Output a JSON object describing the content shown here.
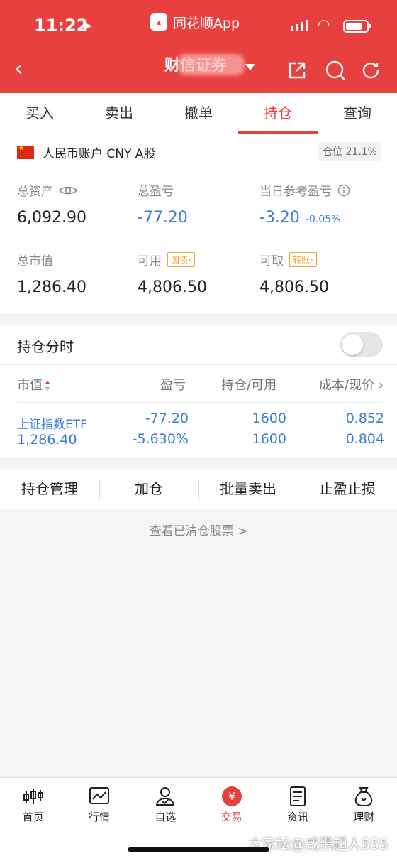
{
  "status_bar": {
    "time": "11:22",
    "app_name": "同花顺App"
  },
  "header": {
    "title": "财信证券",
    "accent_color": "#e8403f"
  },
  "tabs": [
    {
      "label": "买入"
    },
    {
      "label": "卖出"
    },
    {
      "label": "撤单"
    },
    {
      "label": "持仓",
      "active": true
    },
    {
      "label": "查询"
    }
  ],
  "account": {
    "name": "人民币账户 CNY A股",
    "position_ratio": "仓位 21.1%",
    "total_assets": {
      "label": "总资产",
      "value": "6,092.90"
    },
    "total_pnl": {
      "label": "总盈亏",
      "value": "-77.20"
    },
    "daily_pnl": {
      "label": "当日参考盈亏",
      "value": "-3.20",
      "pct": "-0.05%"
    },
    "market_value": {
      "label": "总市值",
      "value": "1,286.40"
    },
    "available": {
      "label": "可用",
      "tag": "国债",
      "value": "4,806.50"
    },
    "withdrawable": {
      "label": "可取",
      "tag": "转账",
      "value": "4,806.50"
    }
  },
  "position_timeshare": {
    "label": "持仓分时",
    "enabled": false
  },
  "table": {
    "headers": [
      "市值",
      "盈亏",
      "持仓/可用",
      "成本/现价"
    ],
    "rows": [
      {
        "name": "上证指数ETF",
        "market_value": "1,286.40",
        "pnl": "-77.20",
        "pnl_pct": "-5.630%",
        "holding": "1600",
        "available": "1600",
        "cost": "0.852",
        "price": "0.804"
      }
    ]
  },
  "actions": [
    "持仓管理",
    "加仓",
    "批量卖出",
    "止盈止损"
  ],
  "cleared_link": "查看已清仓股票 >",
  "bottom_nav": [
    {
      "label": "首页",
      "icon": "candlestick-icon"
    },
    {
      "label": "行情",
      "icon": "chart-icon"
    },
    {
      "label": "自选",
      "icon": "user-check-icon"
    },
    {
      "label": "交易",
      "icon": "yen-icon",
      "active": true
    },
    {
      "label": "资讯",
      "icon": "document-icon"
    },
    {
      "label": "理财",
      "icon": "money-bag-icon"
    }
  ],
  "watermark": "大家坛@咸蛋超人555"
}
